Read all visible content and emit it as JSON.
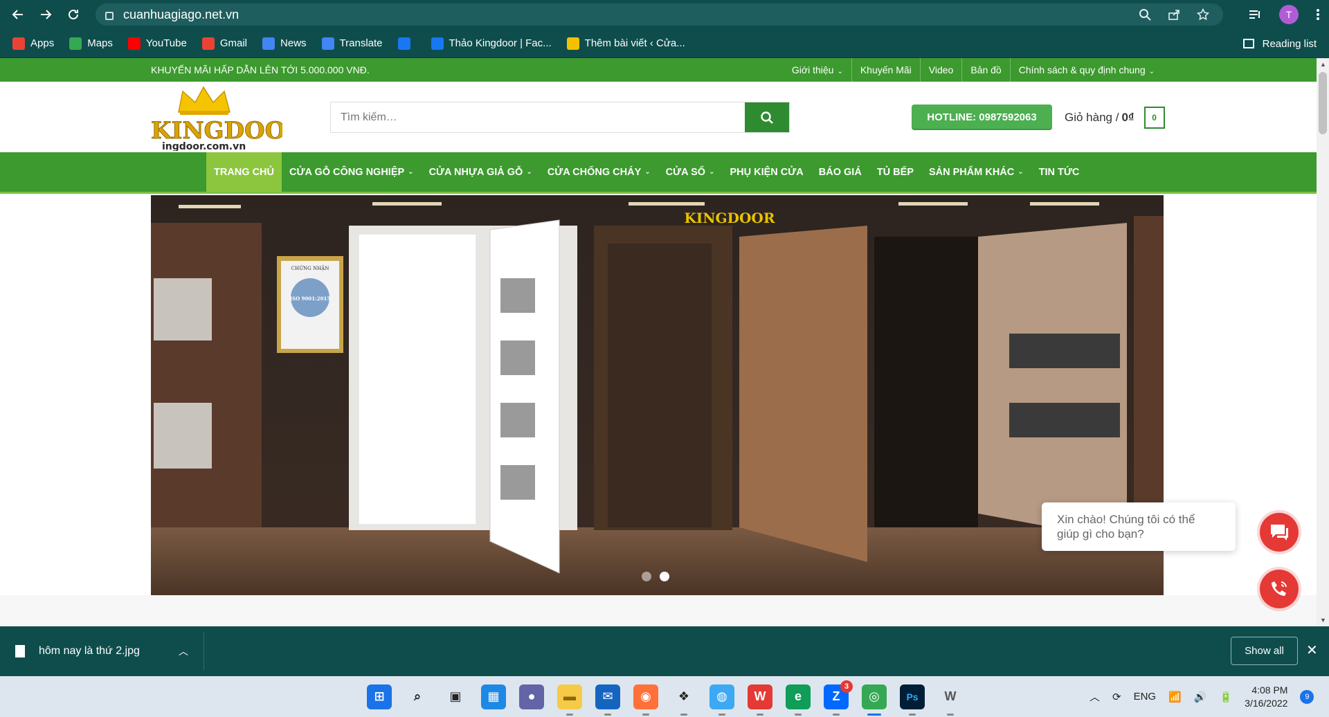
{
  "browser": {
    "url": "cuanhuagiago.net.vn",
    "bookmarks": [
      {
        "label": "Apps",
        "icon": "apps-grid-icon",
        "color": "#ea4335"
      },
      {
        "label": "Maps",
        "icon": "maps-icon",
        "color": "#34a853"
      },
      {
        "label": "YouTube",
        "icon": "youtube-icon",
        "color": "#ff0000"
      },
      {
        "label": "Gmail",
        "icon": "gmail-icon",
        "color": "#ea4335"
      },
      {
        "label": "News",
        "icon": "news-icon",
        "color": "#4285f4"
      },
      {
        "label": "Translate",
        "icon": "translate-icon",
        "color": "#4285f4"
      },
      {
        "label": "",
        "icon": "facebook-icon",
        "color": "#1877f2"
      },
      {
        "label": "Thảo Kingdoor | Fac...",
        "icon": "facebook-icon",
        "color": "#1877f2"
      },
      {
        "label": "Thêm bài viết ‹ Cửa...",
        "icon": "crown-icon",
        "color": "#f2c200"
      }
    ],
    "reading_list": "Reading list",
    "avatar_letter": "T"
  },
  "topbar": {
    "promo": "KHUYẾN MÃI HẤP DẪN LÊN TỚI 5.000.000 VNĐ.",
    "links": [
      "Giới thiệu",
      "Khuyến Mãi",
      "Video",
      "Bản đồ",
      "Chính sách & quy định chung"
    ]
  },
  "header": {
    "logo_text": "KINGDOOR",
    "logo_sub": "ingdoor.com.vn",
    "search_placeholder": "Tìm kiếm…",
    "hotline": "HOTLINE: 0987592063",
    "cart_label": "Giỏ hàng /",
    "cart_total": "0₫",
    "cart_count": "0"
  },
  "nav": {
    "items": [
      {
        "label": "TRANG CHỦ",
        "caret": false,
        "active": true
      },
      {
        "label": "CỬA GỖ CÔNG NGHIỆP",
        "caret": true,
        "active": false
      },
      {
        "label": "CỬA NHỰA GIẢ GỖ",
        "caret": true,
        "active": false
      },
      {
        "label": "CỬA CHỐNG CHÁY",
        "caret": true,
        "active": false
      },
      {
        "label": "CỬA SỔ",
        "caret": true,
        "active": false
      },
      {
        "label": "PHỤ KIỆN CỬA",
        "caret": false,
        "active": false
      },
      {
        "label": "BÁO GIÁ",
        "caret": false,
        "active": false
      },
      {
        "label": "TỦ BẾP",
        "caret": false,
        "active": false
      },
      {
        "label": "SẢN PHẨM KHÁC",
        "caret": true,
        "active": false
      },
      {
        "label": "TIN TỨC",
        "caret": false,
        "active": false
      }
    ]
  },
  "hero": {
    "brand_text": "KINGDOOR",
    "cert_title": "CHỨNG NHẬN",
    "cert_code": "ISO 9001:2015",
    "slides": 2,
    "active_slide": 2
  },
  "chat": {
    "greeting": "Xin chào! Chúng tôi có thể giúp gì cho bạn?"
  },
  "download_bar": {
    "file": "hôm nay là thứ 2.jpg",
    "show_all": "Show all"
  },
  "taskbar": {
    "apps": [
      "windows-start-icon",
      "search-icon",
      "task-view-icon",
      "widgets-icon",
      "teams-chat-icon",
      "file-explorer-icon",
      "mail-icon",
      "firefox-icon",
      "dropbox-icon",
      "maps-app-icon",
      "wps-icon",
      "edge-icon",
      "zalo-icon",
      "chrome-icon",
      "photoshop-icon",
      "word-icon"
    ],
    "zalo_badge": "3",
    "ps_label": "Ps",
    "lang": "ENG",
    "time": "4:08 PM",
    "date": "3/16/2022",
    "notifications": "9"
  },
  "colors": {
    "chrome": "#0f4d4d",
    "green": "#3c9a2e",
    "accent_green": "#8cc63f",
    "red": "#e53935"
  }
}
